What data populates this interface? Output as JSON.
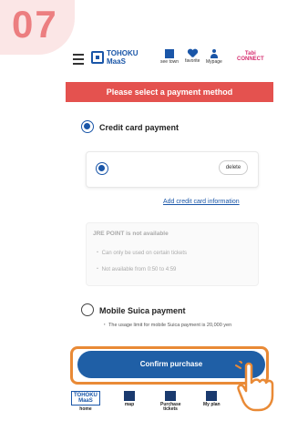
{
  "step": {
    "number": "07"
  },
  "header": {
    "logo_line1": "TOHOKU",
    "logo_line2": "MaaS",
    "nav": [
      {
        "label": "see town",
        "icon": "building-icon"
      },
      {
        "label": "favorite",
        "icon": "heart-icon"
      },
      {
        "label": "Mypage",
        "icon": "person-icon"
      }
    ],
    "tabi_line1": "Tabi",
    "tabi_line2": "CONNECT"
  },
  "banner": {
    "text": "Please select a payment method"
  },
  "credit": {
    "label": "Credit card payment",
    "delete_label": "delete",
    "add_link": "Add credit card information"
  },
  "jre": {
    "title": "JRE POINT is not available",
    "items": [
      "・ Can only be used on certain tickets",
      "・ Not available from 0:50 to 4:59"
    ]
  },
  "suica": {
    "label": "Mobile Suica payment",
    "note": "・ The usage limit for mobile Suica payment is 20,000 yen"
  },
  "confirm": {
    "label": "Confirm purchase"
  },
  "bottom_nav": [
    {
      "label": "home"
    },
    {
      "label": "map"
    },
    {
      "label": "Purchase tickets"
    },
    {
      "label": "My plan"
    }
  ],
  "colors": {
    "primary": "#1f5fa6",
    "banner": "#e4524f",
    "highlight": "#e98a36",
    "step": "#ec7e80"
  }
}
